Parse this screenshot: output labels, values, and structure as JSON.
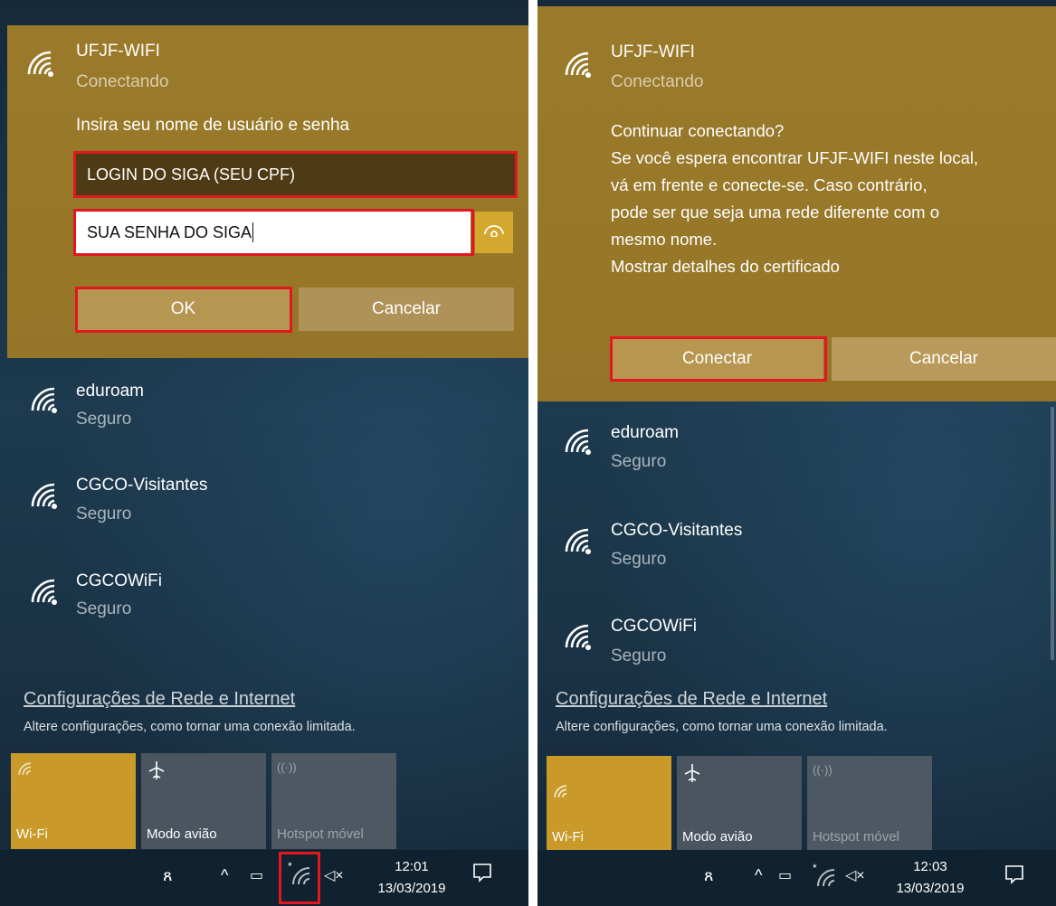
{
  "left": {
    "active_network": {
      "name": "UFJF-WIFI",
      "status": "Conectando"
    },
    "prompt": "Insira seu nome de usuário e senha",
    "username_value": "LOGIN DO SIGA (SEU CPF)",
    "password_value": "SUA SENHA DO SIGA",
    "ok_label": "OK",
    "cancel_label": "Cancelar",
    "networks": [
      {
        "name": "eduroam",
        "status": "Seguro"
      },
      {
        "name": "CGCO-Visitantes",
        "status": "Seguro"
      },
      {
        "name": "CGCOWiFi",
        "status": "Seguro"
      }
    ],
    "settings_link": "Configurações de Rede e Internet",
    "settings_desc": "Altere configurações, como tornar uma conexão limitada.",
    "tiles": [
      {
        "label": "Wi-Fi",
        "icon": "wifi-icon",
        "state": "on"
      },
      {
        "label": "Modo avião",
        "icon": "airplane-icon",
        "state": "off"
      },
      {
        "label": "Hotspot móvel",
        "icon": "hotspot-icon",
        "state": "disabled"
      }
    ],
    "clock": {
      "time": "12:01",
      "date": "13/03/2019"
    }
  },
  "right": {
    "active_network": {
      "name": "UFJF-WIFI",
      "status": "Conectando"
    },
    "message_lines": [
      "Continuar conectando?",
      "Se você espera encontrar UFJF-WIFI neste local,",
      "vá em frente e conecte-se. Caso contrário,",
      "pode ser que seja uma rede diferente com o",
      "mesmo nome.",
      "Mostrar detalhes do certificado"
    ],
    "connect_label": "Conectar",
    "cancel_label": "Cancelar",
    "networks": [
      {
        "name": "eduroam",
        "status": "Seguro"
      },
      {
        "name": "CGCO-Visitantes",
        "status": "Seguro"
      },
      {
        "name": "CGCOWiFi",
        "status": "Seguro"
      }
    ],
    "settings_link": "Configurações de Rede e Internet",
    "settings_desc": "Altere configurações, como tornar uma conexão limitada.",
    "tiles": [
      {
        "label": "Wi-Fi",
        "icon": "wifi-icon",
        "state": "on"
      },
      {
        "label": "Modo avião",
        "icon": "airplane-icon",
        "state": "off"
      },
      {
        "label": "Hotspot móvel",
        "icon": "hotspot-icon",
        "state": "disabled"
      }
    ],
    "clock": {
      "time": "12:03",
      "date": "13/03/2019"
    }
  },
  "colors": {
    "accent": "#c99a2a",
    "expanded_bg": "#9a7a2a",
    "highlight": "#e2171f",
    "taskbar": "#10222f"
  }
}
